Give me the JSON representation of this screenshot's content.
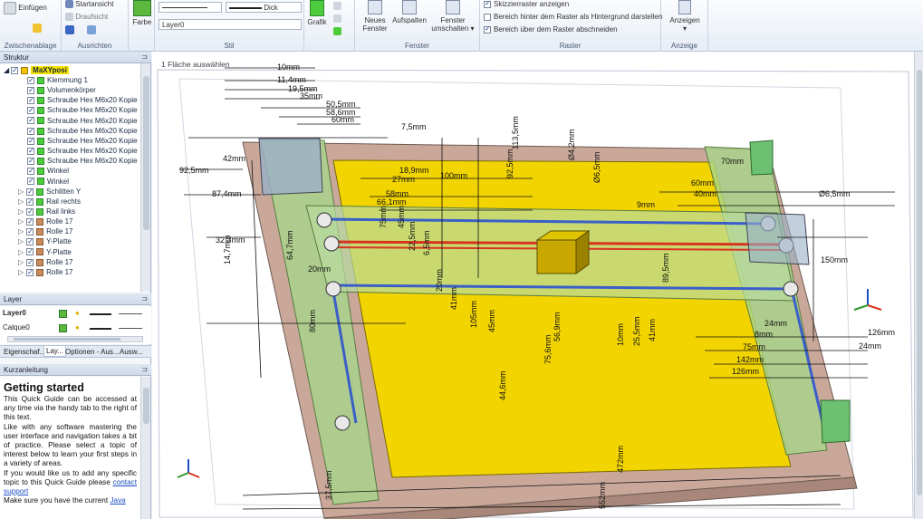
{
  "ribbon": {
    "clipboard": {
      "paste_label": "Einfügen",
      "group_label": "Zwischenablage"
    },
    "align": {
      "start_view": "Startansicht",
      "top_view": "Draufsicht",
      "group_label": "Ausrichten"
    },
    "color": {
      "label": "Farbe"
    },
    "style": {
      "line_weight": "Dick",
      "layer_select": "Layer0",
      "group_label": "Stil"
    },
    "grafik": {
      "label": "Grafik"
    },
    "window": {
      "new_label_1": "Neues",
      "new_label_2": "Fenster",
      "split_label": "Aufspalten",
      "switch_label_1": "Fenster",
      "switch_label_2": "umschalten",
      "group_label": "Fenster"
    },
    "raster": {
      "opt1": "Skizzierraster anzeigen",
      "opt2": "Bereich hinter dem Raster als Hintergrund darstellen",
      "opt3": "Bereich über dem Raster abschneiden",
      "group_label": "Raster"
    },
    "display": {
      "label": "Anzeigen",
      "group_label": "Anzeige"
    }
  },
  "structure": {
    "title": "Struktur",
    "root": "MaXYposi",
    "items": [
      {
        "label": "Klemmung 1",
        "type": "green"
      },
      {
        "label": "Volumenkörper",
        "type": "green"
      },
      {
        "label": "Schraube Hex M6x20 Kopie",
        "type": "green"
      },
      {
        "label": "Schraube Hex M6x20 Kopie",
        "type": "green"
      },
      {
        "label": "Schraube Hex M6x20 Kopie",
        "type": "green"
      },
      {
        "label": "Schraube Hex M6x20 Kopie",
        "type": "green"
      },
      {
        "label": "Schraube Hex M6x20 Kopie",
        "type": "green"
      },
      {
        "label": "Schraube Hex M6x20 Kopie",
        "type": "green"
      },
      {
        "label": "Schraube Hex M6x20 Kopie",
        "type": "green"
      },
      {
        "label": "Winkel",
        "type": "green"
      },
      {
        "label": "Winkel",
        "type": "green"
      },
      {
        "label": "Schlitten Y",
        "type": "green"
      },
      {
        "label": "Rail rechts",
        "type": "green"
      },
      {
        "label": "Rail links",
        "type": "green"
      },
      {
        "label": "Rolle 17",
        "type": "brown"
      },
      {
        "label": "Rolle 17",
        "type": "brown"
      },
      {
        "label": "Y-Platte",
        "type": "brown"
      },
      {
        "label": "Y-Platte",
        "type": "brown"
      },
      {
        "label": "Rolle 17",
        "type": "brown"
      },
      {
        "label": "Rolle 17",
        "type": "brown"
      }
    ]
  },
  "layer": {
    "title": "Layer",
    "rows": [
      {
        "name": "Layer0"
      },
      {
        "name": "Calque0"
      }
    ],
    "tabs": [
      "Eigenschaf...",
      "Lay...",
      "Optionen - Aus...",
      "Ausw..."
    ]
  },
  "guide": {
    "title": "Kurzanleitung",
    "heading": "Getting started",
    "p1": "This Quick Guide can be accessed at any time via the handy tab to the right of this text.",
    "p2": "Like with any software mastering the user interface and navigation takes a bit of practice. Please select a topic of interest below to learn your first steps in a variety of areas.",
    "p3a": "If you would like us to add any specific topic to this Quick Guide please ",
    "p3link": "contact support",
    "p4a": "Make sure you have the current ",
    "p4link": "Java"
  },
  "viewport": {
    "status": "1 Fläche auswählen",
    "dims": {
      "d10": "10mm",
      "d114": "11,4mm",
      "d195": "19,5mm",
      "d35": "35mm",
      "d505": "50,5mm",
      "d586": "58,6mm",
      "d60": "60mm",
      "d75": "7,5mm",
      "d42": "42mm",
      "d925": "92,5mm",
      "d874": "87,4mm",
      "d323": "32,3mm",
      "d147": "14,7mm",
      "d647": "64,7mm",
      "d80": "80mm",
      "d1135": "113,5mm",
      "d925b": "92,5mm",
      "d42b": "Ø4,2mm",
      "d65b": "Ø6,5mm",
      "d189": "18,9mm",
      "d27": "27mm",
      "d100": "100mm",
      "d58": "58mm",
      "d661": "66,1mm",
      "d75b": "75mm",
      "d45": "45mm",
      "d225": "22,5mm",
      "d65": "6,5mm",
      "d20": "20mm",
      "d41": "41mm",
      "d105": "105mm",
      "d45b": "45mm",
      "d569": "56,9mm",
      "d756": "75,6mm",
      "d446": "44,6mm",
      "d10b": "10mm",
      "d255": "25,5mm",
      "d41b": "41mm",
      "d60b": "60mm",
      "d40b": "40mm",
      "d9": "9mm",
      "d895": "89,5mm",
      "d70": "70mm",
      "d65c": "Ø6,5mm",
      "d150": "150mm",
      "d24": "24mm",
      "d8": "8mm",
      "d75c": "75mm",
      "d142": "142mm",
      "d126": "126mm",
      "d126b": "126mm",
      "d24b": "24mm",
      "d472": "472mm",
      "d552": "552mm",
      "d375": "37,5mm"
    }
  },
  "colors": {
    "ribbon_bg": "#e7edf6",
    "yellow_plate": "#f2d400",
    "base": "#c9a89a",
    "rail_green": "#a8d48a",
    "belt_blue": "#3b5fc8",
    "belt_red": "#d8331e"
  }
}
